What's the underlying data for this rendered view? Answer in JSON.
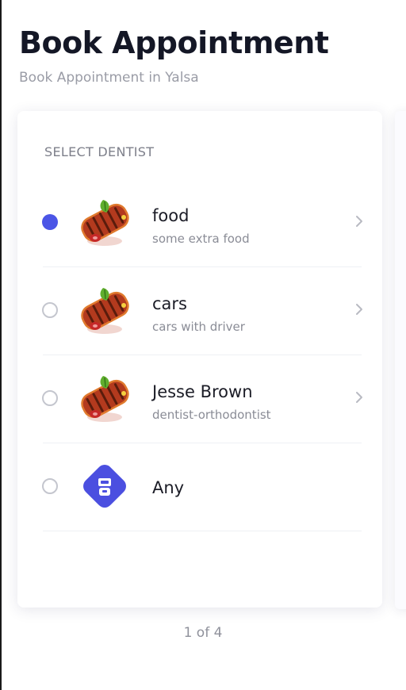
{
  "header": {
    "title": "Book Appointment",
    "subtitle": "Book Appointment in Yalsa"
  },
  "card": {
    "section_label": "SELECT DENTIST",
    "options": [
      {
        "title": "food",
        "subtitle": "some extra food",
        "selected": true,
        "avatar_icon": "grilled-food-icon"
      },
      {
        "title": "cars",
        "subtitle": "cars with driver",
        "selected": false,
        "avatar_icon": "grilled-food-icon"
      },
      {
        "title": "Jesse Brown",
        "subtitle": "dentist-orthodontist",
        "selected": false,
        "avatar_icon": "grilled-food-icon"
      },
      {
        "title": "Any",
        "selected": false,
        "avatar_icon": "any-dentist-icon"
      }
    ]
  },
  "pager": {
    "label": "1 of 4"
  },
  "colors": {
    "accent": "#4b55e6",
    "title": "#141726",
    "muted": "#9a9ca6"
  }
}
